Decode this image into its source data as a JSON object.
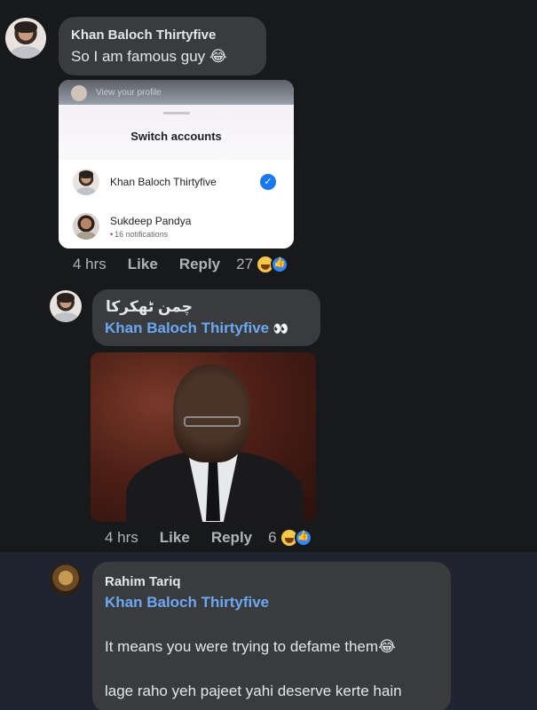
{
  "comments": [
    {
      "author": "Khan Baloch Thirtyfive",
      "text": "So I am famous guy 😂",
      "embedded_screenshot": {
        "top_bar_text": "View your profile",
        "title": "Switch accounts",
        "accounts": [
          {
            "name": "Khan Baloch Thirtyfive",
            "selected": true
          },
          {
            "name": "Sukdeep Pandya",
            "notifications": "16 notifications"
          }
        ]
      },
      "time": "4 hrs",
      "like_label": "Like",
      "reply_label": "Reply",
      "reaction_count": "27"
    },
    {
      "author": "چمن ٹھکرکا",
      "mention": "Khan Baloch Thirtyfive",
      "mention_suffix": "👀",
      "time": "4 hrs",
      "like_label": "Like",
      "reply_label": "Reply",
      "reaction_count": "6"
    },
    {
      "author": "Rahim Tariq",
      "mention": "Khan Baloch Thirtyfive",
      "line1": "It means you were trying to defame them😂",
      "line2": "lage raho yeh pajeet yahi deserve kerte hain"
    }
  ],
  "colors": {
    "background": "#18191a",
    "bubble": "#3a3b3c",
    "mention": "#6aa8f5",
    "highlight_band": "#1f2430"
  },
  "icons": [
    "haha-reaction-icon",
    "like-reaction-icon",
    "check-icon",
    "eyes-emoji"
  ]
}
